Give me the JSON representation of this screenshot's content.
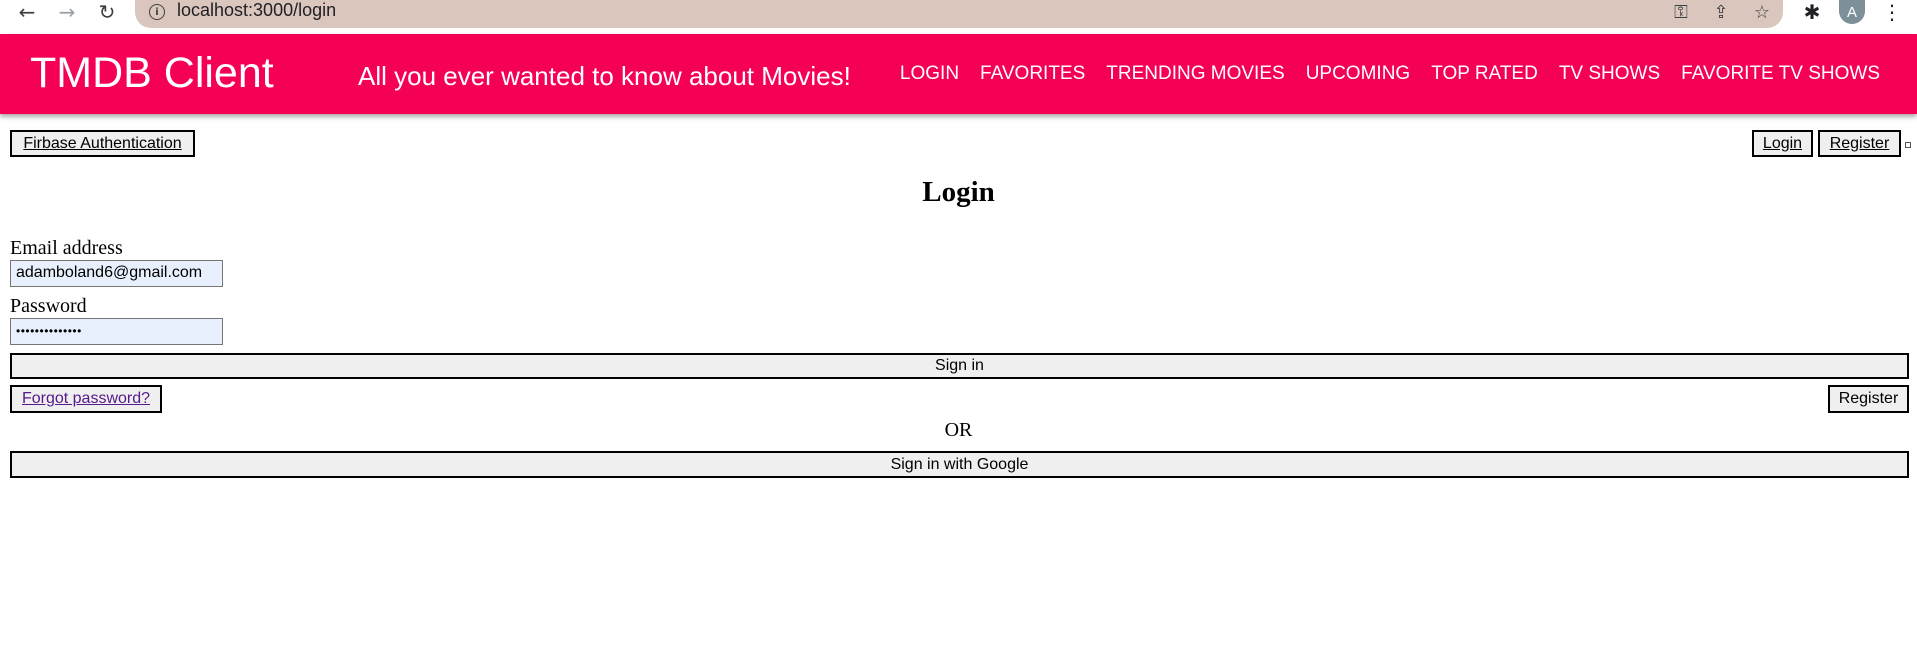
{
  "browser": {
    "url": "localhost:3000/login",
    "profile_initial": "A",
    "back_glyph": "←",
    "forward_glyph": "→",
    "reload_glyph": "↻",
    "info_glyph": "i",
    "key_glyph": "⚿",
    "share_glyph": "⇪",
    "star_glyph": "☆",
    "puzzle_glyph": "✱",
    "menu_glyph": "⋮"
  },
  "appbar": {
    "title": "TMDB Client",
    "tagline": "All you ever wanted to know about Movies!",
    "background": "#f50057",
    "nav": [
      "LOGIN",
      "FAVORITES",
      "TRENDING MOVIES",
      "UPCOMING",
      "TOP RATED",
      "TV SHOWS",
      "FAVORITE TV SHOWS"
    ]
  },
  "auth_bar": {
    "brand_label": "Firbase Authentication",
    "login_label": "Login",
    "register_label": "Register"
  },
  "login_form": {
    "heading": "Login",
    "email_label": "Email address",
    "email_value": "adamboland6@gmail.com",
    "password_label": "Password",
    "password_value": "••••••••••••••",
    "sign_in_label": "Sign in",
    "forgot_label": "Forgot password?",
    "register_label": "Register",
    "or_text": "OR",
    "google_label": "Sign in with Google"
  }
}
